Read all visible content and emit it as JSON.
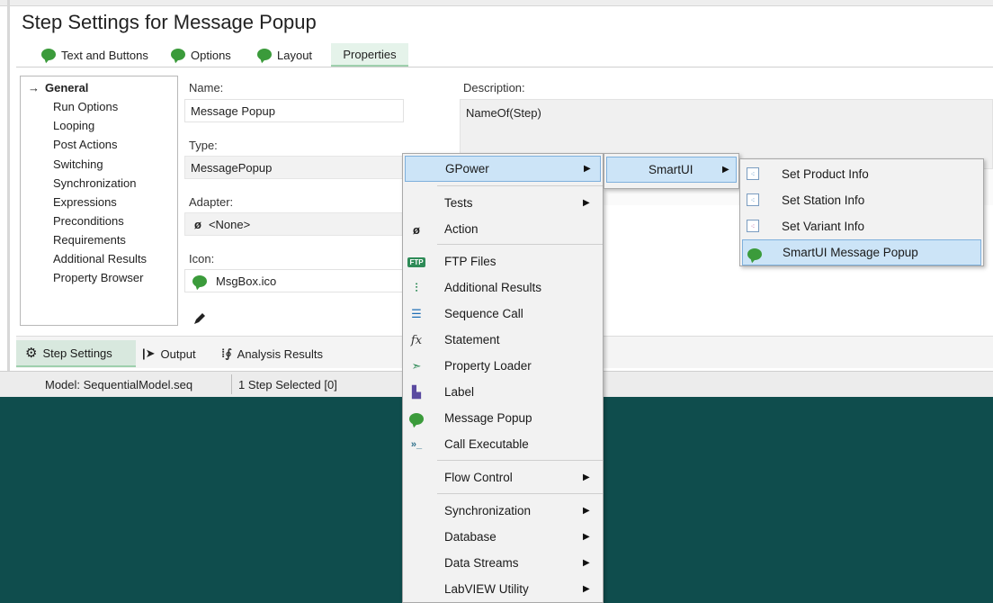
{
  "title": "Step Settings for Message Popup",
  "tabs": [
    "Text and Buttons",
    "Options",
    "Layout",
    "Properties"
  ],
  "sidebar": {
    "items": [
      "General",
      "Run Options",
      "Looping",
      "Post Actions",
      "Switching",
      "Synchronization",
      "Expressions",
      "Preconditions",
      "Requirements",
      "Additional Results",
      "Property Browser"
    ]
  },
  "form": {
    "name_label": "Name:",
    "name_value": "Message Popup",
    "type_label": "Type:",
    "type_value": "MessagePopup",
    "adapter_label": "Adapter:",
    "adapter_value": "<None>",
    "icon_label": "Icon:",
    "icon_value": "MsgBox.ico",
    "description_label": "Description:",
    "description_value": "NameOf(Step)"
  },
  "bottom_tabs": [
    "Step Settings",
    "Output",
    "Analysis Results"
  ],
  "status": {
    "model": "Model: SequentialModel.seq",
    "selection": "1 Step Selected [0]"
  },
  "menu1": {
    "top": "GPower",
    "items": [
      {
        "label": "Tests",
        "icon": "none",
        "submenu": true
      },
      {
        "label": "Action",
        "icon": "null-set-icon",
        "submenu": false
      },
      {
        "label": "FTP Files",
        "icon": "ftp-icon",
        "submenu": false
      },
      {
        "label": "Additional Results",
        "icon": "additional-results-icon",
        "submenu": false
      },
      {
        "label": "Sequence Call",
        "icon": "sequence-call-icon",
        "submenu": false
      },
      {
        "label": "Statement",
        "icon": "fx-icon",
        "submenu": false
      },
      {
        "label": "Property Loader",
        "icon": "property-loader-icon",
        "submenu": false
      },
      {
        "label": "Label",
        "icon": "label-icon",
        "submenu": false
      },
      {
        "label": "Message Popup",
        "icon": "message-bubble-icon",
        "submenu": false
      },
      {
        "label": "Call Executable",
        "icon": "terminal-icon",
        "submenu": false
      }
    ],
    "flow_control": "Flow Control",
    "bottom_items": [
      "Synchronization",
      "Database",
      "Data Streams",
      "LabVIEW Utility"
    ]
  },
  "menu2": {
    "item": "SmartUI"
  },
  "menu3": {
    "items": [
      "Set Product Info",
      "Set Station Info",
      "Set Variant Info",
      "SmartUI Message Popup"
    ]
  },
  "colors": {
    "background": "#0f4d4d",
    "accent_green": "#3b9b3b",
    "selection": "#cce4f7",
    "selection_border": "#7fb0dc"
  }
}
